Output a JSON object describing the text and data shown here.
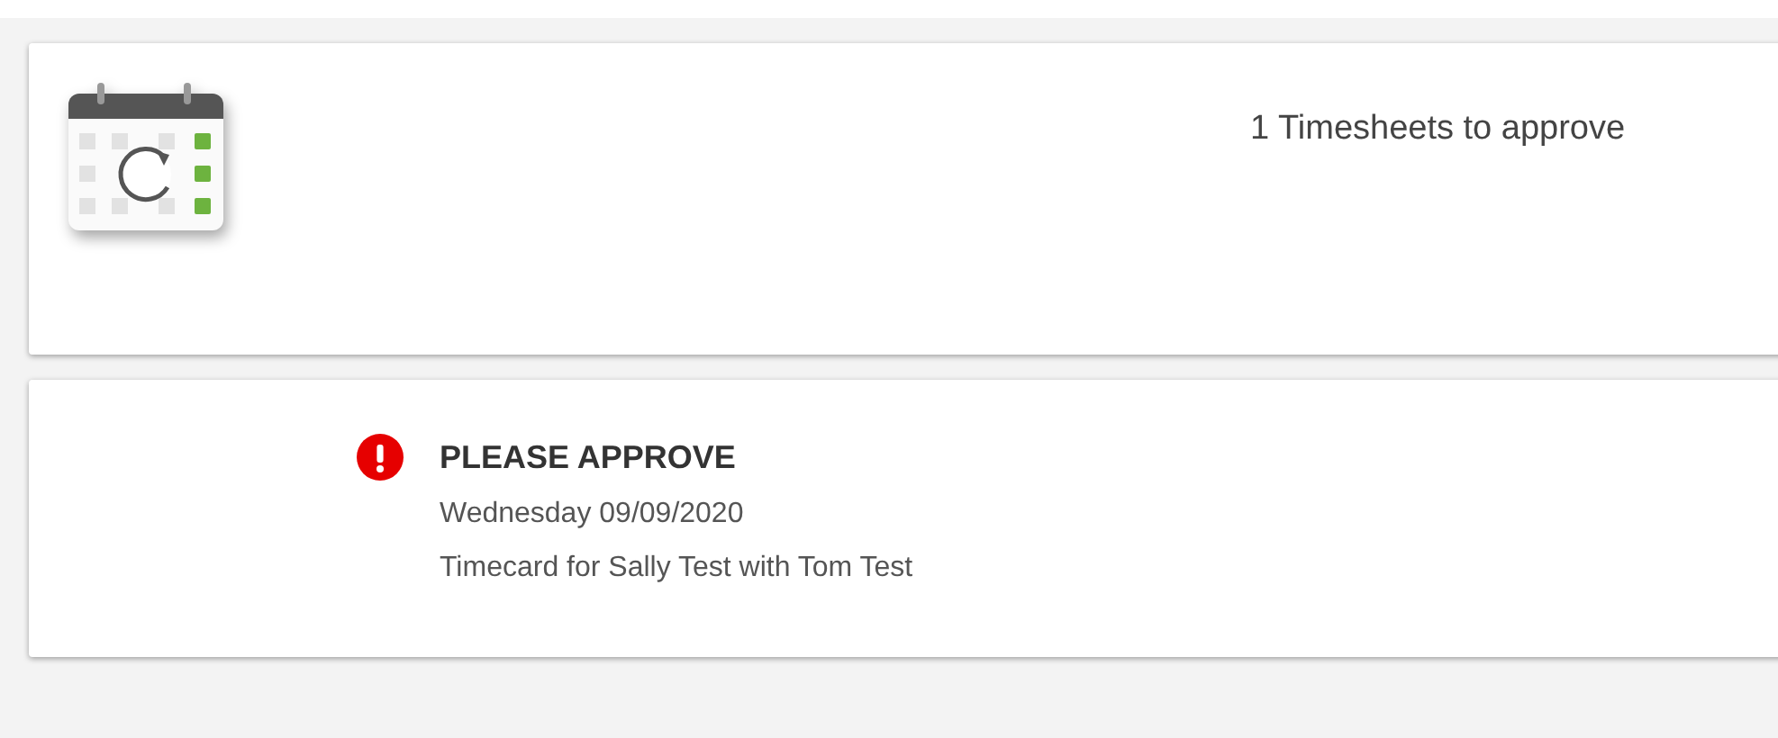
{
  "summary_card": {
    "count_text": "1 Timesheets to approve"
  },
  "approvals": [
    {
      "kind": "alert",
      "title": "PLEASE APPROVE",
      "date": "Wednesday 09/09/2020",
      "description": "Timecard for Sally Test with Tom Test"
    }
  ]
}
